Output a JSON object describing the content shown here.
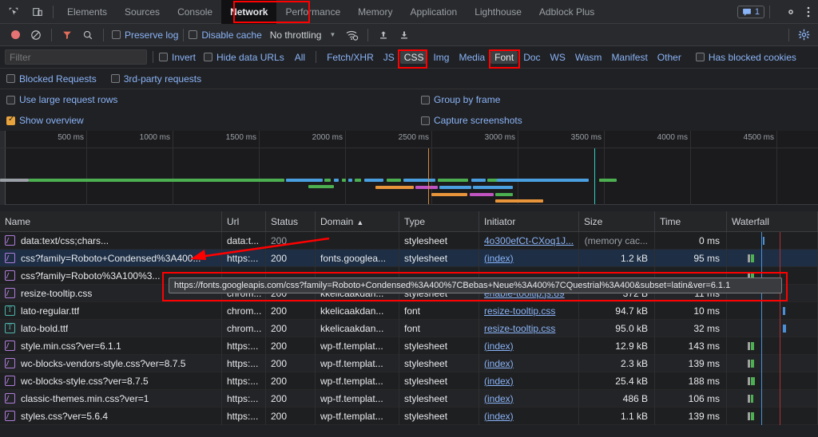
{
  "tabbar": {
    "icons": [
      "inspect-icon",
      "device-toolbar-icon"
    ],
    "tabs": [
      {
        "label": "Elements",
        "active": false
      },
      {
        "label": "Sources",
        "active": false
      },
      {
        "label": "Console",
        "active": false
      },
      {
        "label": "Network",
        "active": true
      },
      {
        "label": "Performance",
        "active": false
      },
      {
        "label": "Memory",
        "active": false
      },
      {
        "label": "Application",
        "active": false
      },
      {
        "label": "Lighthouse",
        "active": false
      },
      {
        "label": "Adblock Plus",
        "active": false
      }
    ],
    "message_count": "1"
  },
  "toolbar": {
    "preserve_log": {
      "label": "Preserve log",
      "checked": false
    },
    "disable_cache": {
      "label": "Disable cache",
      "checked": false
    },
    "throttling": "No throttling"
  },
  "filterbar": {
    "placeholder": "Filter",
    "value": "",
    "invert": {
      "label": "Invert",
      "checked": false
    },
    "hide_data_urls": {
      "label": "Hide data URLs",
      "checked": false
    },
    "types": [
      {
        "label": "All",
        "selected": false
      },
      {
        "label": "Fetch/XHR",
        "selected": false
      },
      {
        "label": "JS",
        "selected": false
      },
      {
        "label": "CSS",
        "selected": true
      },
      {
        "label": "Img",
        "selected": false
      },
      {
        "label": "Media",
        "selected": false
      },
      {
        "label": "Font",
        "selected": true
      },
      {
        "label": "Doc",
        "selected": false
      },
      {
        "label": "WS",
        "selected": false
      },
      {
        "label": "Wasm",
        "selected": false
      },
      {
        "label": "Manifest",
        "selected": false
      },
      {
        "label": "Other",
        "selected": false
      }
    ],
    "has_blocked_cookies": {
      "label": "Has blocked cookies",
      "checked": false
    },
    "blocked_requests": {
      "label": "Blocked Requests",
      "checked": false
    },
    "third_party": {
      "label": "3rd-party requests",
      "checked": false
    }
  },
  "options": {
    "use_large_request_rows": {
      "label": "Use large request rows",
      "checked": false
    },
    "group_by_frame": {
      "label": "Group by frame",
      "checked": false
    },
    "show_overview": {
      "label": "Show overview",
      "checked": true
    },
    "capture_screenshots": {
      "label": "Capture screenshots",
      "checked": false
    }
  },
  "overview": {
    "ticks": [
      "500 ms",
      "1000 ms",
      "1500 ms",
      "2000 ms",
      "2500 ms",
      "3000 ms",
      "3500 ms",
      "4000 ms",
      "4500 ms"
    ],
    "dclEvent": "2500 ms",
    "loadEvent": "3500 ms"
  },
  "table": {
    "columns": [
      "Name",
      "Url",
      "Status",
      "Domain",
      "Type",
      "Initiator",
      "Size",
      "Time",
      "Waterfall"
    ],
    "sorted_column": "Domain",
    "sort_direction": "▲",
    "rows": [
      {
        "icon": "css-file-icon",
        "name": "data:text/css;chars...",
        "url": "data:t...",
        "status": "200",
        "domain": "",
        "type": "stylesheet",
        "initiator": "4o300efCt-CXoq1J...",
        "size": "(memory cac...",
        "time": "0 ms",
        "selected": false,
        "size_dim": true,
        "status_dim": true
      },
      {
        "icon": "css-file-icon",
        "name": "css?family=Roboto+Condensed%3A400...",
        "url": "https:...",
        "status": "200",
        "domain": "fonts.googlea...",
        "type": "stylesheet",
        "initiator": "(index)",
        "size": "1.2 kB",
        "time": "95 ms",
        "selected": true
      },
      {
        "icon": "css-file-icon",
        "name": "css?family=Roboto%3A100%3...",
        "url": "",
        "status": "",
        "domain": "",
        "type": "",
        "initiator": "",
        "size": "",
        "time": "",
        "selected": false
      },
      {
        "icon": "css-file-icon",
        "name": "resize-tooltip.css",
        "url": "chrom...",
        "status": "200",
        "domain": "kkelicaakdan...",
        "type": "stylesheet",
        "initiator": "enable-tooltip.js:89",
        "size": "372 B",
        "time": "11 ms",
        "selected": false
      },
      {
        "icon": "font-file-icon",
        "name": "lato-regular.ttf",
        "url": "chrom...",
        "status": "200",
        "domain": "kkelicaakdan...",
        "type": "font",
        "initiator": "resize-tooltip.css",
        "size": "94.7 kB",
        "time": "10 ms",
        "selected": false
      },
      {
        "icon": "font-file-icon",
        "name": "lato-bold.ttf",
        "url": "chrom...",
        "status": "200",
        "domain": "kkelicaakdan...",
        "type": "font",
        "initiator": "resize-tooltip.css",
        "size": "95.0 kB",
        "time": "32 ms",
        "selected": false
      },
      {
        "icon": "css-file-icon",
        "name": "style.min.css?ver=6.1.1",
        "url": "https:...",
        "status": "200",
        "domain": "wp-tf.templat...",
        "type": "stylesheet",
        "initiator": "(index)",
        "size": "12.9 kB",
        "time": "143 ms",
        "selected": false
      },
      {
        "icon": "css-file-icon",
        "name": "wc-blocks-vendors-style.css?ver=8.7.5",
        "url": "https:...",
        "status": "200",
        "domain": "wp-tf.templat...",
        "type": "stylesheet",
        "initiator": "(index)",
        "size": "2.3 kB",
        "time": "139 ms",
        "selected": false
      },
      {
        "icon": "css-file-icon",
        "name": "wc-blocks-style.css?ver=8.7.5",
        "url": "https:...",
        "status": "200",
        "domain": "wp-tf.templat...",
        "type": "stylesheet",
        "initiator": "(index)",
        "size": "25.4 kB",
        "time": "188 ms",
        "selected": false
      },
      {
        "icon": "css-file-icon",
        "name": "classic-themes.min.css?ver=1",
        "url": "https:...",
        "status": "200",
        "domain": "wp-tf.templat...",
        "type": "stylesheet",
        "initiator": "(index)",
        "size": "486 B",
        "time": "106 ms",
        "selected": false
      },
      {
        "icon": "css-file-icon",
        "name": "styles.css?ver=5.6.4",
        "url": "https:...",
        "status": "200",
        "domain": "wp-tf.templat...",
        "type": "stylesheet",
        "initiator": "(index)",
        "size": "1.1 kB",
        "time": "139 ms",
        "selected": false
      }
    ]
  },
  "tooltip": {
    "text": "https://fonts.googleapis.com/css?family=Roboto+Condensed%3A400%7CBebas+Neue%3A400%7CQuestrial%3A400&subset=latin&ver=6.1.1"
  },
  "annotations": {
    "color": "#ff0000",
    "boxes": [
      "network-tab",
      "css-filter",
      "font-filter",
      "tooltip-url"
    ],
    "arrow": "red-arrow-to-selected-row"
  }
}
